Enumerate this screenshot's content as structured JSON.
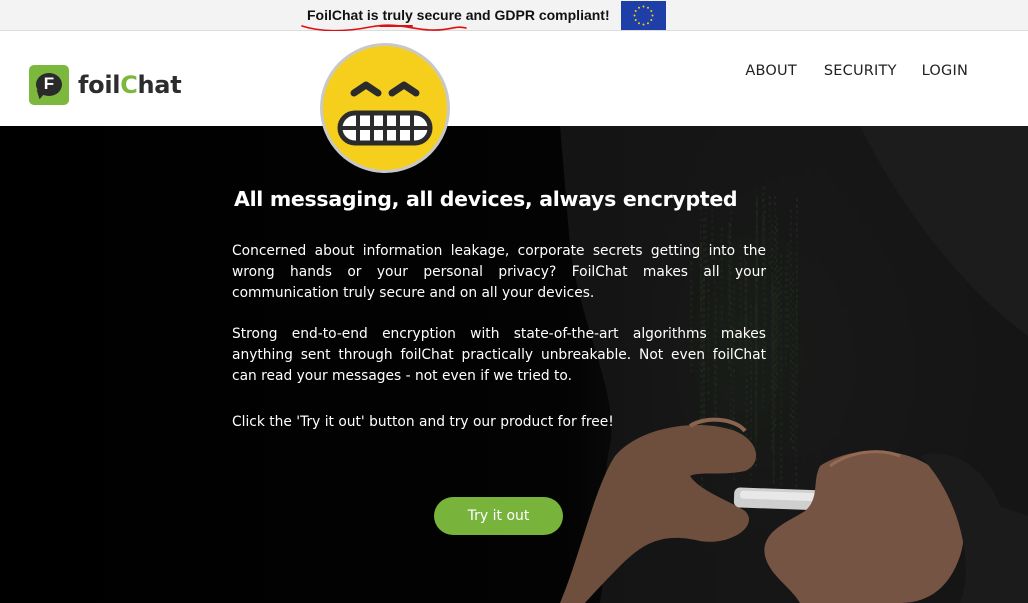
{
  "banner": {
    "prefix": "FoilChat is ",
    "underlined": "truly",
    "suffix": " secure and GDPR compliant!",
    "flag_color": "#1f3fa8",
    "flag_icon": "eu-flag-icon"
  },
  "header": {
    "logo": {
      "letter": "F",
      "word_part1": "foil",
      "word_part2": "C",
      "word_part3": "hat",
      "accent": "#7cb83e"
    },
    "nav": {
      "about": "ABOUT",
      "security": "SECURITY",
      "login": "LOGIN"
    }
  },
  "sticker": {
    "icon": "grimacing-face-icon"
  },
  "hero": {
    "title": "All messaging, all devices, always encrypted",
    "paragraph1": "Concerned about information leakage, corporate secrets getting into the wrong hands or your personal privacy? FoilChat makes all your communication truly secure and on all your devices.",
    "paragraph2": "Strong end-to-end encryption with state-of-the-art algorithms makes anything sent through foilChat practically unbreakable. Not even foilChat can read your messages - not even if we tried to.",
    "paragraph3": "Click the 'Try it out' button and try our product for free!",
    "cta_label": "Try it out",
    "cta_color": "#78b43c"
  }
}
